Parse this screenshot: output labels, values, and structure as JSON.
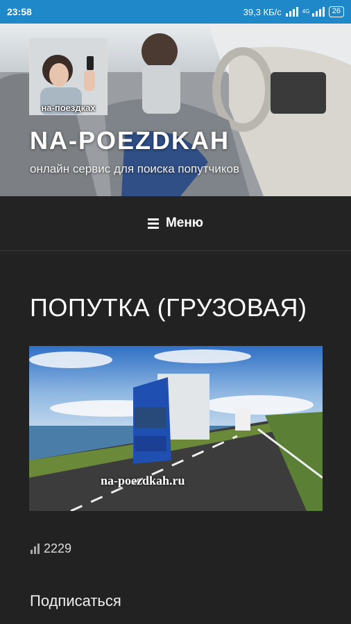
{
  "status_bar": {
    "time": "23:58",
    "network_speed": "39,3 КБ/с",
    "network_type": "4G",
    "battery": "26"
  },
  "header": {
    "logo_caption": "на-поездках",
    "site_title": "NA-POEZDKAH",
    "tagline": "онлайн сервис для поиска попутчиков"
  },
  "menu": {
    "label": "Меню",
    "icon": "hamburger-icon"
  },
  "post": {
    "title": "ПОПУТКА (ГРУЗОВАЯ)",
    "image_watermark": "na-poezdkah.ru",
    "views": "2229",
    "views_icon": "bar-chart-icon"
  },
  "sidebar": {
    "subscribe_label": "Подписаться"
  },
  "colors": {
    "status_bar": "#1f88c9",
    "page_background": "#222222",
    "truck": "#1f4fb0"
  }
}
